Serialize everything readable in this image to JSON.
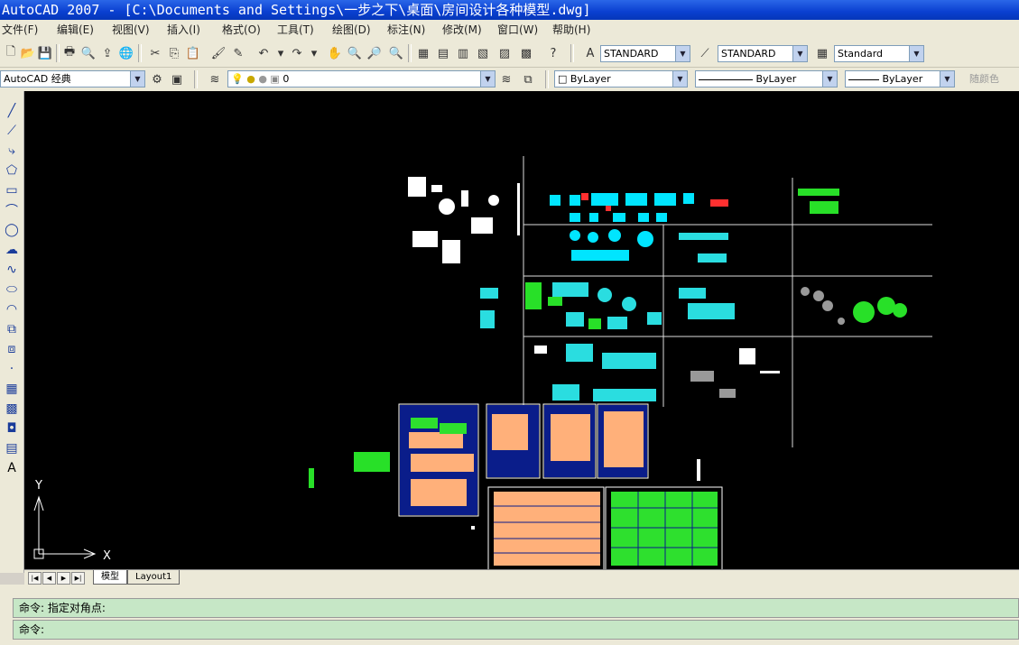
{
  "window": {
    "title": "AutoCAD 2007 - [C:\\Documents and Settings\\一步之下\\桌面\\房间设计各种模型.dwg]"
  },
  "menu": [
    "文件(F)",
    "编辑(E)",
    "视图(V)",
    "插入(I)",
    "格式(O)",
    "工具(T)",
    "绘图(D)",
    "标注(N)",
    "修改(M)",
    "窗口(W)",
    "帮助(H)"
  ],
  "styles": {
    "text_style": "STANDARD",
    "dim_style": "STANDARD",
    "table_style": "Standard"
  },
  "workspace": "AutoCAD 经典",
  "layer": {
    "current": "0"
  },
  "properties": {
    "color": "ByLayer",
    "linetype": "ByLayer",
    "lineweight": "ByLayer",
    "plotstyle": "随颜色"
  },
  "ucs": {
    "x_label": "X",
    "y_label": "Y"
  },
  "tabs": {
    "model": "模型",
    "layout": "Layout1"
  },
  "command": {
    "history": "命令: 指定对角点:",
    "prompt": "命令:"
  },
  "colors": {
    "canvas": "#000000",
    "titlebar": "#0a3fd0",
    "command_bg": "#c6e7c6"
  }
}
